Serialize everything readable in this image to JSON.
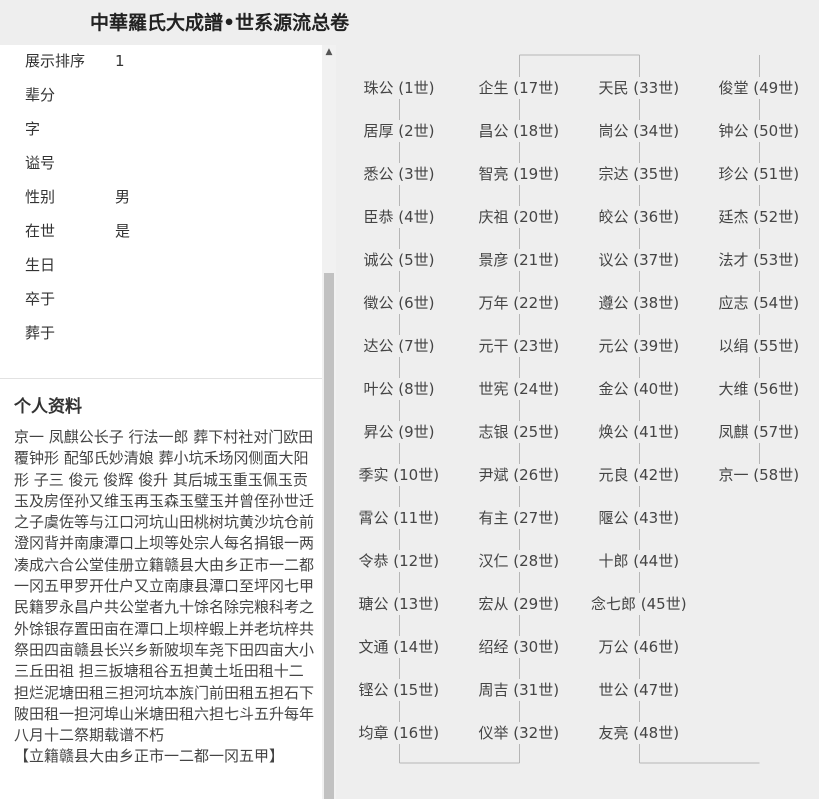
{
  "header": {
    "title": "中華羅氏大成譜•世系源流总卷"
  },
  "attributes": [
    {
      "label": "展示排序",
      "value": "1"
    },
    {
      "label": "辈分",
      "value": ""
    },
    {
      "label": "字",
      "value": ""
    },
    {
      "label": "谥号",
      "value": ""
    },
    {
      "label": "性别",
      "value": "男"
    },
    {
      "label": "在世",
      "value": "是"
    },
    {
      "label": "生日",
      "value": ""
    },
    {
      "label": "卒于",
      "value": ""
    },
    {
      "label": "葬于",
      "value": ""
    }
  ],
  "profile": {
    "heading": "个人资料",
    "text": "京一 凤麒公长子 行法一郎 葬下村社对门欧田覆钟形 配邹氏妙清娘 葬小坑禾场冈侧面大阳形 子三 俊元 俊辉 俊升 其后城玉重玉佩玉贡玉及房侄孙又维玉再玉森玉璧玉并曾侄孙世迁之子虞佐等与江口河坑山田桃树坑黄沙坑仓前澄冈背并南康潭口上坝等处宗人每名捐银一两凑成六合公堂佳册立籍赣县大由乡正市一二都一冈五甲罗开仕户又立南康县潭口至坪冈七甲民籍罗永昌户共公堂者九十馀名除完粮科考之外馀银存置田亩在潭口上坝梓蝦上并老坑梓共祭田四亩赣县长兴乡新陂坝车尧下田四亩大小三丘田祖 担三扳塘租谷五担黄土坵田租十二担烂泥塘田租三担河坑本族门前田租五担石下陂田租一担河埠山米塘田租六担七斗五升每年八月十二祭期载谱不朽",
    "footer": "【立籍赣县大由乡正市一二都一冈五甲】"
  },
  "generations": [
    "珠公 (1世)",
    "居厚 (2世)",
    "悉公 (3世)",
    "臣恭 (4世)",
    "诚公 (5世)",
    "徵公 (6世)",
    "达公 (7世)",
    "叶公 (8世)",
    "昇公 (9世)",
    "季实 (10世)",
    "霄公 (11世)",
    "令恭 (12世)",
    "瑭公 (13世)",
    "文通 (14世)",
    "铿公 (15世)",
    "均章 (16世)",
    "企生 (17世)",
    "昌公 (18世)",
    "智亮 (19世)",
    "庆祖 (20世)",
    "景彦 (21世)",
    "万年 (22世)",
    "元干 (23世)",
    "世宪 (24世)",
    "志银 (25世)",
    "尹斌 (26世)",
    "有主 (27世)",
    "汉仁 (28世)",
    "宏从 (29世)",
    "绍经 (30世)",
    "周吉 (31世)",
    "仪举 (32世)",
    "天民 (33世)",
    "峝公 (34世)",
    "宗达 (35世)",
    "皎公 (36世)",
    "议公 (37世)",
    "遵公 (38世)",
    "元公 (39世)",
    "金公 (40世)",
    "焕公 (41世)",
    "元良 (42世)",
    "隁公 (43世)",
    "十郎 (44世)",
    "念七郎 (45世)",
    "万公 (46世)",
    "世公 (47世)",
    "友亮 (48世)",
    "俊堂 (49世)",
    "钟公 (50世)",
    "珍公 (51世)",
    "廷杰 (52世)",
    "法才 (53世)",
    "应志 (54世)",
    "以绢 (55世)",
    "大维 (56世)",
    "凤麒 (57世)",
    "京一 (58世)"
  ],
  "colors": {
    "header_bg": "#eeeeee",
    "tree_bg": "#eeeeee",
    "connector": "#b5b5b5"
  },
  "icons": {
    "scroll_up": "▲"
  }
}
